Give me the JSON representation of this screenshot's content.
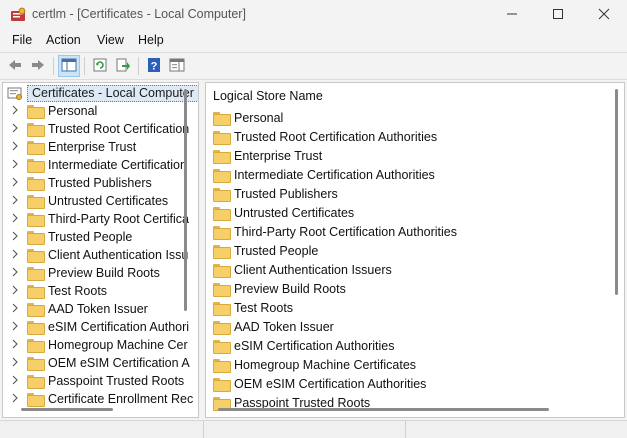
{
  "window": {
    "title": "certlm - [Certificates - Local Computer]",
    "icons": [
      "certificate-app-icon",
      "minimize-icon",
      "maximize-icon",
      "close-icon"
    ]
  },
  "menu": [
    "File",
    "Action",
    "View",
    "Help"
  ],
  "toolbar": {
    "buttons": [
      "back-arrow-icon",
      "forward-arrow-icon",
      "show-hide-console-tree-icon",
      "refresh-icon",
      "export-list-icon",
      "help-icon",
      "action-pane-icon"
    ]
  },
  "tree": {
    "root": "Certificates - Local Computer",
    "items": [
      "Personal",
      "Trusted Root Certification",
      "Enterprise Trust",
      "Intermediate Certification",
      "Trusted Publishers",
      "Untrusted Certificates",
      "Third-Party Root Certifica",
      "Trusted People",
      "Client Authentication Issu",
      "Preview Build Roots",
      "Test Roots",
      "AAD Token Issuer",
      "eSIM Certification Authori",
      "Homegroup Machine Cer",
      "OEM eSIM Certification A",
      "Passpoint Trusted Roots",
      "Certificate Enrollment Rec"
    ]
  },
  "list": {
    "header": "Logical Store Name",
    "items": [
      "Personal",
      "Trusted Root Certification Authorities",
      "Enterprise Trust",
      "Intermediate Certification Authorities",
      "Trusted Publishers",
      "Untrusted Certificates",
      "Third-Party Root Certification Authorities",
      "Trusted People",
      "Client Authentication Issuers",
      "Preview Build Roots",
      "Test Roots",
      "AAD Token Issuer",
      "eSIM Certification Authorities",
      "Homegroup Machine Certificates",
      "OEM eSIM Certification Authorities",
      "Passpoint Trusted Roots"
    ]
  },
  "colors": {
    "folder": "#f6cf68",
    "selection": "#dde9f5",
    "accent": "#cce4f7"
  }
}
